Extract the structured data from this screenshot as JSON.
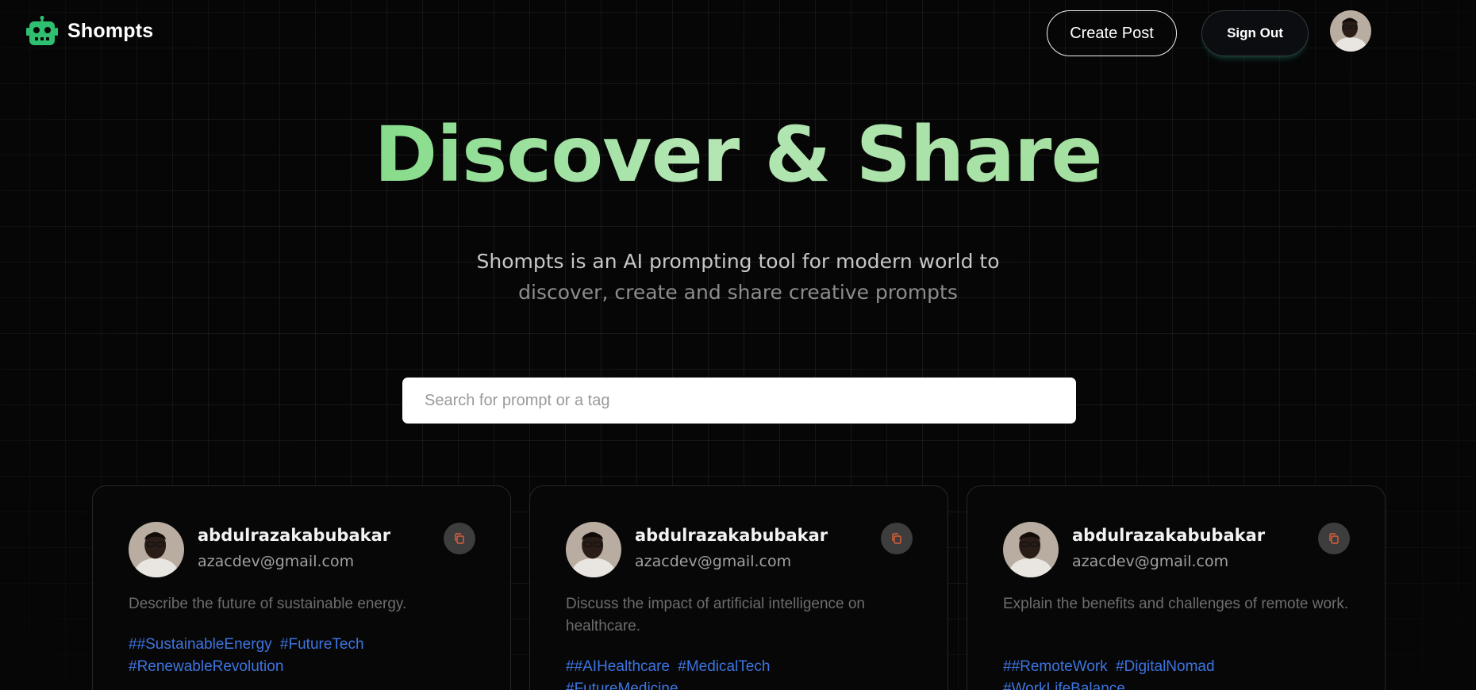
{
  "header": {
    "brand": "Shompts",
    "create_post_label": "Create Post",
    "sign_out_label": "Sign Out"
  },
  "hero": {
    "title": "Discover & Share",
    "subtitle_line1": "Shompts is an AI prompting tool for modern world to",
    "subtitle_line2": "discover, create and share creative prompts"
  },
  "search": {
    "placeholder": "Search for prompt or a tag",
    "value": ""
  },
  "cards": [
    {
      "username": "abdulrazakabubakar",
      "email": "azacdev@gmail.com",
      "prompt": "Describe the future of sustainable energy.",
      "tags": [
        "##SustainableEnergy",
        "#FutureTech",
        "#RenewableRevolution"
      ]
    },
    {
      "username": "abdulrazakabubakar",
      "email": "azacdev@gmail.com",
      "prompt": "Discuss the impact of artificial intelligence on healthcare.",
      "tags": [
        "##AIHealthcare",
        "#MedicalTech",
        "#FutureMedicine"
      ]
    },
    {
      "username": "abdulrazakabubakar",
      "email": "azacdev@gmail.com",
      "prompt": "Explain the benefits and challenges of remote work.",
      "tags": [
        "##RemoteWork",
        "#DigitalNomad",
        "#WorkLifeBalance"
      ]
    }
  ],
  "colors": {
    "background": "#060606",
    "brand_green": "#2fbf71",
    "title_gradient_start": "#86dc8a",
    "title_gradient_end": "#a3e0a0",
    "tag_blue": "#3d74e0",
    "copy_icon_orange": "#e0603a"
  },
  "icons": {
    "logo": "robot-icon",
    "copy": "copy-icon",
    "avatar": "user-avatar"
  }
}
